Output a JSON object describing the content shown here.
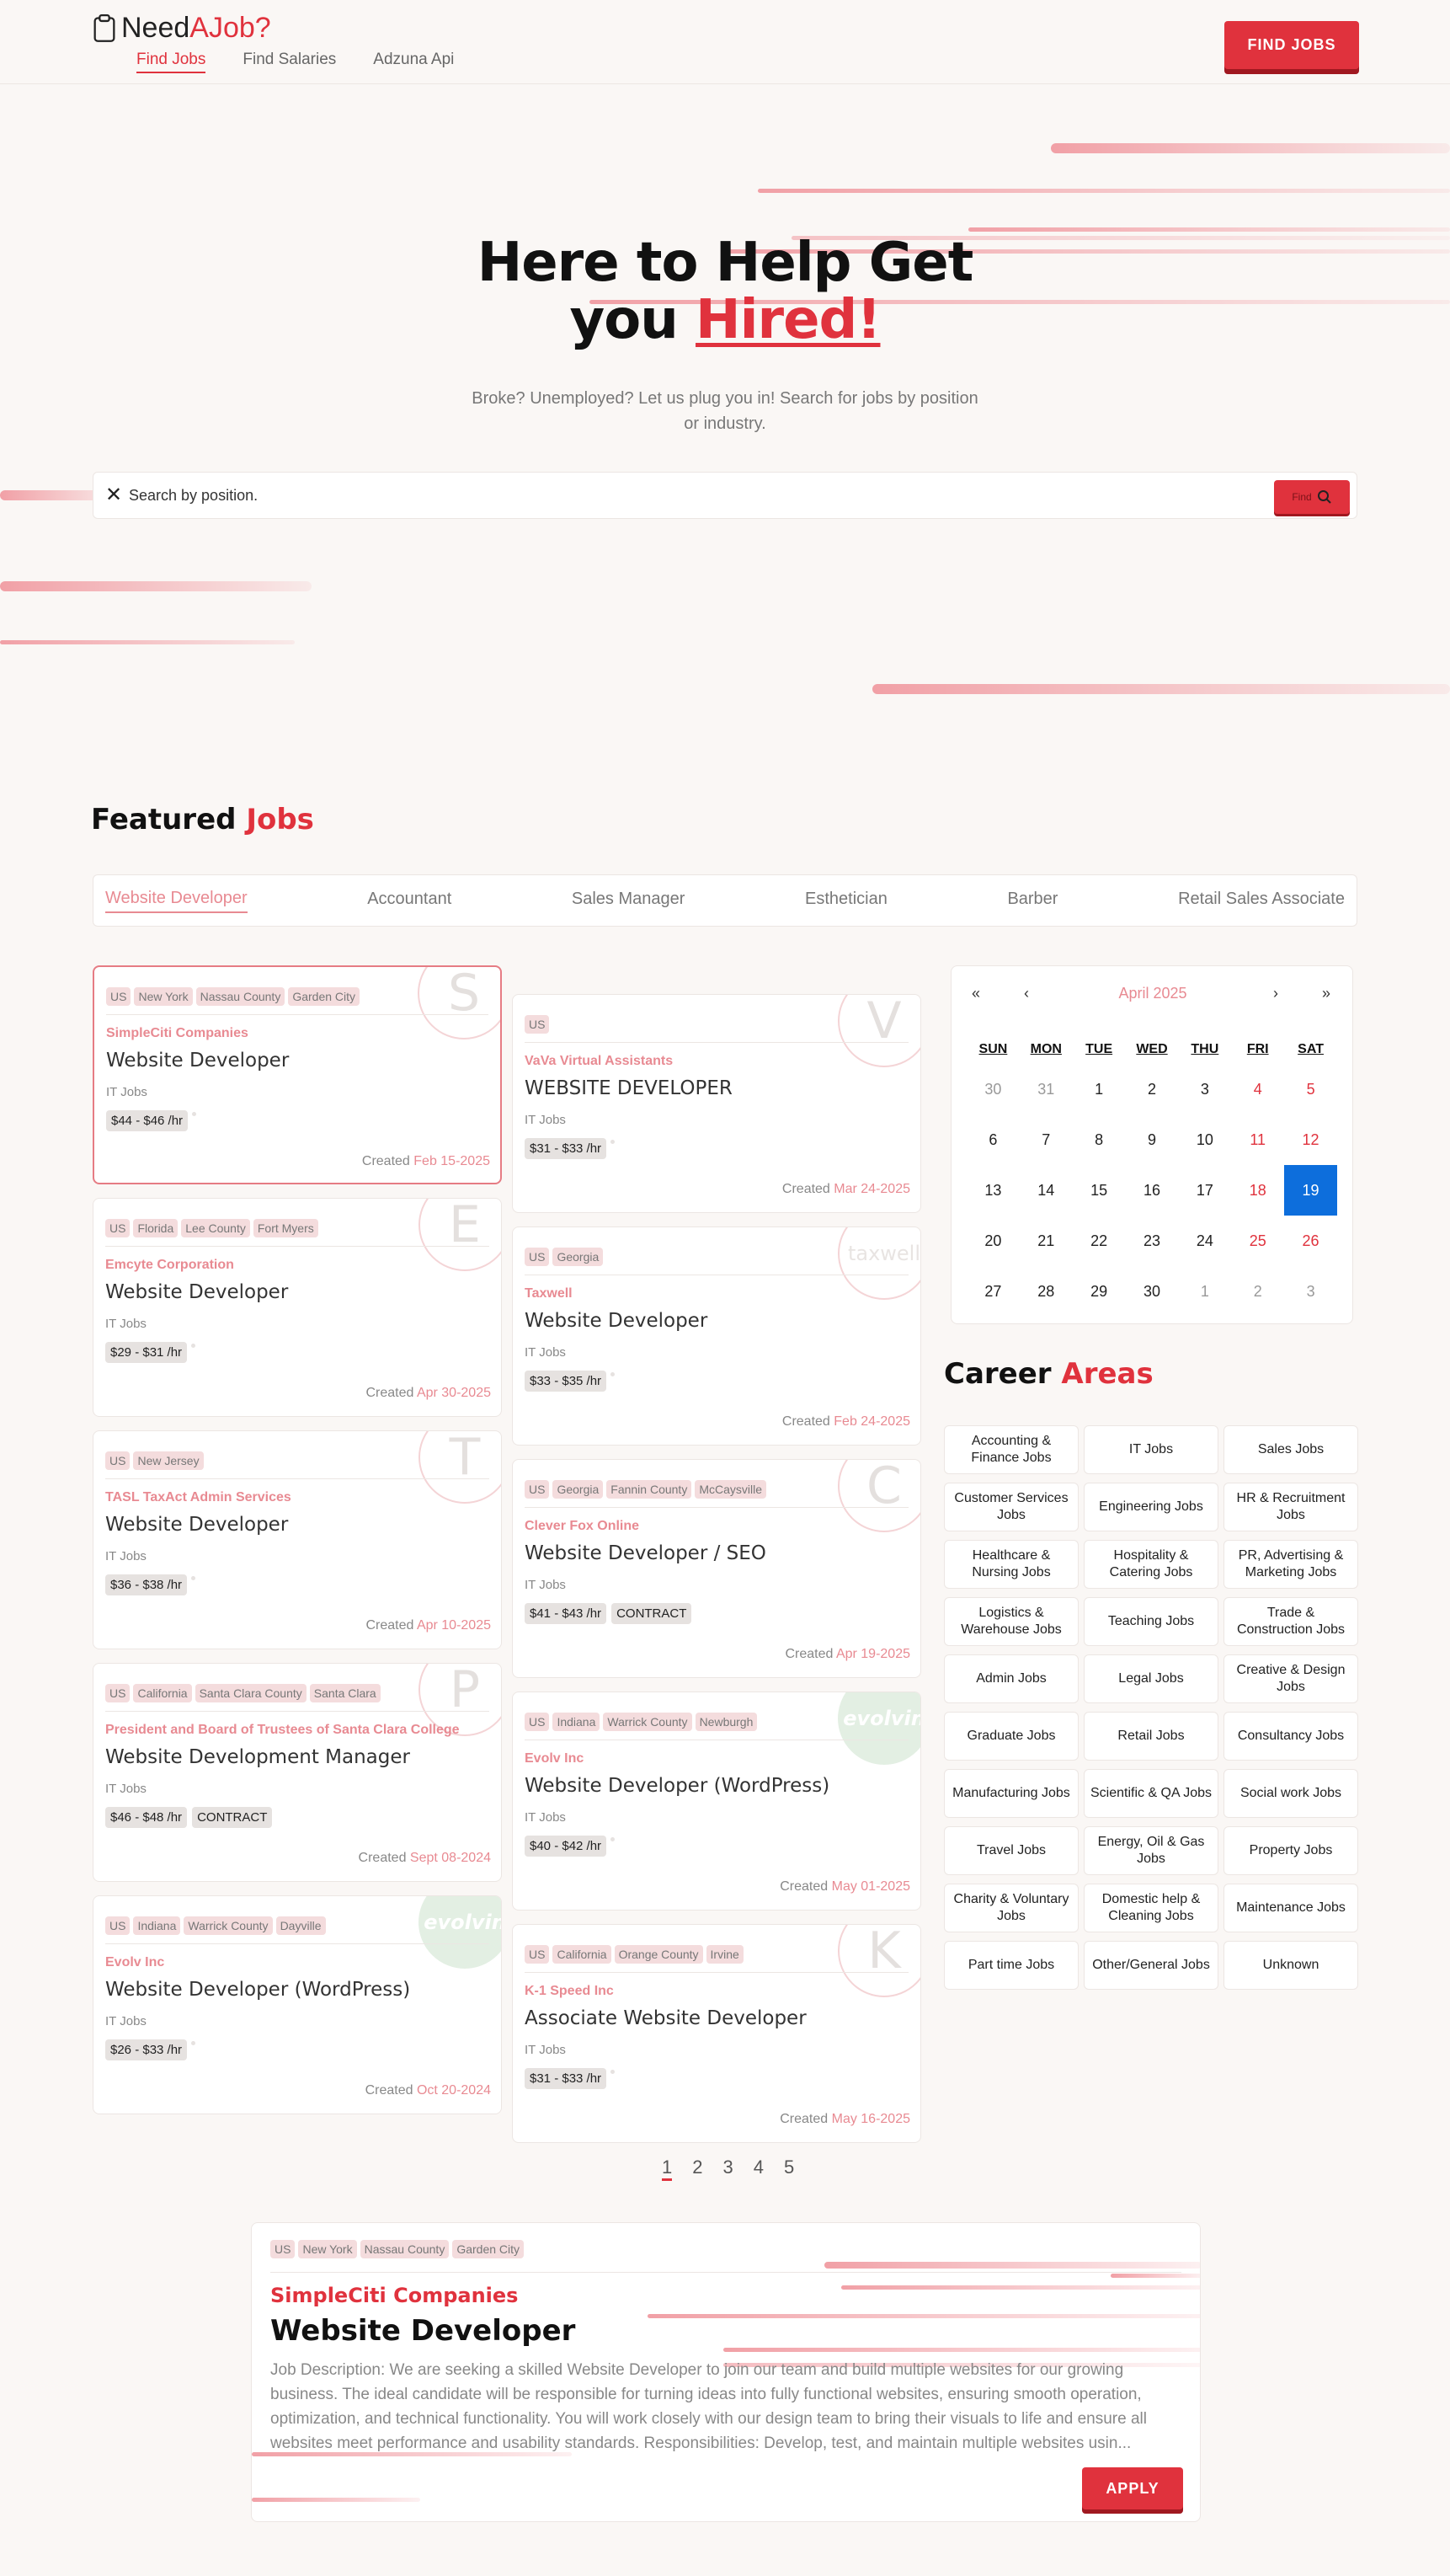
{
  "header": {
    "logo_part1": "Need",
    "logo_part2": "AJob?",
    "nav": [
      "Find Jobs",
      "Find Salaries",
      "Adzuna Api"
    ],
    "find_jobs_label": "FIND JOBS"
  },
  "hero": {
    "title_line1": "Here to Help Get",
    "title_line2_prefix": "you",
    "title_highlight": "Hired!",
    "subtitle": "Broke? Unemployed? Let us plug you in! Search for jobs by position or industry.",
    "search_placeholder": "Search by position.",
    "find_label": "Find"
  },
  "featured": {
    "title": "Featured",
    "title_hl": "Jobs",
    "tabs": [
      "Website Developer",
      "Accountant",
      "Sales Manager",
      "Esthetician",
      "Barber",
      "Retail Sales Associate"
    ],
    "created_label": "Created"
  },
  "jobs": [
    {
      "tags": [
        "US",
        "New York",
        "Nassau County",
        "Garden City"
      ],
      "company": "SimpleCiti Companies",
      "title": "Website Developer",
      "category": "IT Jobs",
      "pay": "$44 - $46 /hr",
      "contract": "",
      "date": "Feb 15-2025",
      "logo": "S"
    },
    {
      "tags": [
        "US"
      ],
      "company": "VaVa Virtual Assistants",
      "title": "WEBSITE DEVELOPER",
      "category": "IT Jobs",
      "pay": "$31 - $33 /hr",
      "contract": "",
      "date": "Mar 24-2025",
      "logo": "V"
    },
    {
      "tags": [
        "US",
        "Florida",
        "Lee County",
        "Fort Myers"
      ],
      "company": "Emcyte Corporation",
      "title": "Website Developer",
      "category": "IT Jobs",
      "pay": "$29 - $31 /hr",
      "contract": "",
      "date": "Apr 30-2025",
      "logo": "E"
    },
    {
      "tags": [
        "US",
        "Georgia"
      ],
      "company": "Taxwell",
      "title": "Website Developer",
      "category": "IT Jobs",
      "pay": "$33 - $35 /hr",
      "contract": "",
      "date": "Feb 24-2025",
      "logo": "taxwell"
    },
    {
      "tags": [
        "US",
        "New Jersey"
      ],
      "company": "TASL TaxAct Admin Services",
      "title": "Website Developer",
      "category": "IT Jobs",
      "pay": "$36 - $38 /hr",
      "contract": "",
      "date": "Apr 10-2025",
      "logo": "T"
    },
    {
      "tags": [
        "US",
        "Georgia",
        "Fannin County",
        "McCaysville"
      ],
      "company": "Clever Fox Online",
      "title": "Website Developer / SEO",
      "category": "IT Jobs",
      "pay": "$41 - $43 /hr",
      "contract": "CONTRACT",
      "date": "Apr 19-2025",
      "logo": "C"
    },
    {
      "tags": [
        "US",
        "California",
        "Santa Clara County",
        "Santa Clara"
      ],
      "company": "President and Board of Trustees of Santa Clara College",
      "title": "Website Development Manager",
      "category": "IT Jobs",
      "pay": "$46 - $48 /hr",
      "contract": "CONTRACT",
      "date": "Sept 08-2024",
      "logo": "P"
    },
    {
      "tags": [
        "US",
        "Indiana",
        "Warrick County",
        "Newburgh"
      ],
      "company": "Evolv Inc",
      "title": "Website Developer (WordPress)",
      "category": "IT Jobs",
      "pay": "$40 - $42 /hr",
      "contract": "",
      "date": "May 01-2025",
      "logo": "evolvin"
    },
    {
      "tags": [
        "US",
        "Indiana",
        "Warrick County",
        "Dayville"
      ],
      "company": "Evolv Inc",
      "title": "Website Developer (WordPress)",
      "category": "IT Jobs",
      "pay": "$26 - $33 /hr",
      "contract": "",
      "date": "Oct 20-2024",
      "logo": "evolvin"
    },
    {
      "tags": [
        "US",
        "California",
        "Orange County",
        "Irvine"
      ],
      "company": "K-1 Speed Inc",
      "title": "Associate Website Developer",
      "category": "IT Jobs",
      "pay": "$31 - $33 /hr",
      "contract": "",
      "date": "May 16-2025",
      "logo": "K"
    }
  ],
  "pagination": [
    "1",
    "2",
    "3",
    "4",
    "5"
  ],
  "calendar": {
    "month": "April 2025",
    "nav": [
      "«",
      "‹",
      "›",
      "»"
    ],
    "weekdays": [
      "SUN",
      "MON",
      "TUE",
      "WED",
      "THU",
      "FRI",
      "SAT"
    ],
    "days": [
      "30",
      "31",
      "1",
      "2",
      "3",
      "4",
      "5",
      "6",
      "7",
      "8",
      "9",
      "10",
      "11",
      "12",
      "13",
      "14",
      "15",
      "16",
      "17",
      "18",
      "19",
      "20",
      "21",
      "22",
      "23",
      "24",
      "25",
      "26",
      "27",
      "28",
      "29",
      "30",
      "1",
      "2",
      "3"
    ],
    "selected": "19",
    "accent": "#0d6edc"
  },
  "career": {
    "title": "Career",
    "title_hl": "Areas",
    "items": [
      "Accounting & Finance Jobs",
      "IT Jobs",
      "Sales Jobs",
      "Customer Services Jobs",
      "Engineering Jobs",
      "HR & Recruitment Jobs",
      "Healthcare & Nursing Jobs",
      "Hospitality & Catering Jobs",
      "PR, Advertising & Marketing Jobs",
      "Logistics & Warehouse Jobs",
      "Teaching Jobs",
      "Trade & Construction Jobs",
      "Admin Jobs",
      "Legal Jobs",
      "Creative & Design Jobs",
      "Graduate Jobs",
      "Retail Jobs",
      "Consultancy Jobs",
      "Manufacturing Jobs",
      "Scientific & QA Jobs",
      "Social work Jobs",
      "Travel Jobs",
      "Energy, Oil & Gas Jobs",
      "Property Jobs",
      "Charity & Voluntary Jobs",
      "Domestic help & Cleaning Jobs",
      "Maintenance Jobs",
      "Part time Jobs",
      "Other/General Jobs",
      "Unknown"
    ]
  },
  "detail": {
    "tags": [
      "US",
      "New York",
      "Nassau County",
      "Garden City"
    ],
    "company": "SimpleCiti Companies",
    "title": "Website Developer",
    "description": "Job Description: We are seeking a skilled Website Developer to join our team and build multiple websites for our growing business. The ideal candidate will be responsible for turning ideas into fully functional websites, ensuring smooth operation, optimization, and technical functionality. You will work closely with our design team to bring their visuals to life and ensure all websites meet performance and usability standards. Responsibilities: Develop, test, and maintain multiple websites usin...",
    "apply_label": "APPLY"
  },
  "colors": {
    "brand": "#e0323d",
    "accent_pink": "#e88a92",
    "calendar_selected": "#0d6edc"
  }
}
